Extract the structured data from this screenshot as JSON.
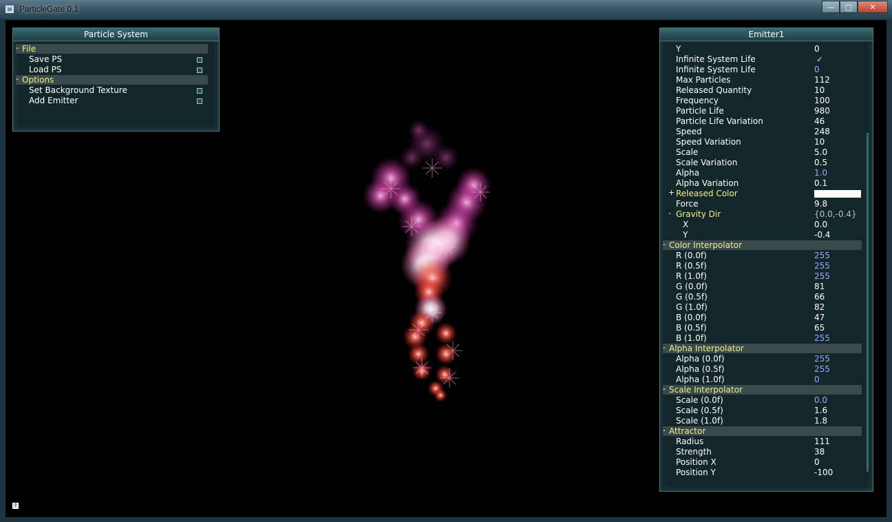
{
  "window": {
    "title": "ParticleGate 0.1",
    "min_label": "—",
    "max_label": "□",
    "close_label": "✕"
  },
  "particle_panel": {
    "title": "Particle System",
    "sections": [
      {
        "label": "File",
        "sign": "-",
        "items": [
          "Save PS",
          "Load PS"
        ]
      },
      {
        "label": "Options",
        "sign": "-",
        "items": [
          "Set Background Texture",
          "Add Emitter"
        ]
      }
    ]
  },
  "emitter_panel": {
    "title": "Emitter1",
    "rows": [
      {
        "label": "Y",
        "value": "0"
      },
      {
        "label": "Infinite System Life",
        "value": "✓",
        "checked": true
      },
      {
        "label": "Infinite System Life",
        "value": "0",
        "color": "blue"
      },
      {
        "label": "Max Particles",
        "value": "112"
      },
      {
        "label": "Released Quantity",
        "value": "10"
      },
      {
        "label": "Frequency",
        "value": "100"
      },
      {
        "label": "Particle Life",
        "value": "980"
      },
      {
        "label": "Particle Life Variation",
        "value": "46"
      },
      {
        "label": "Speed",
        "value": "248"
      },
      {
        "label": "Speed Variation",
        "value": "10"
      },
      {
        "label": "Scale",
        "value": "5.0"
      },
      {
        "label": "Scale Variation",
        "value": "0.5"
      },
      {
        "label": "Alpha",
        "value": "1.0",
        "color": "blue"
      },
      {
        "label": "Alpha Variation",
        "value": "0.1"
      },
      {
        "label": "Released Color",
        "sign": "+",
        "value": "",
        "swatch": "#ffffff",
        "highlight": true
      },
      {
        "label": "Force",
        "value": "9.8"
      },
      {
        "label": "Gravity Dir",
        "sign": "-",
        "value": "{0.0,-0.4}",
        "highlight": true,
        "color": "gray"
      },
      {
        "label": "X",
        "value": "0.0",
        "sub": true
      },
      {
        "label": "Y",
        "value": "-0.4",
        "sub": true
      },
      {
        "label": "Color Interpolator",
        "sign": "-",
        "section": true
      },
      {
        "label": "R (0.0f)",
        "value": "255",
        "color": "blue"
      },
      {
        "label": "R (0.5f)",
        "value": "255",
        "color": "blue"
      },
      {
        "label": "R (1.0f)",
        "value": "255",
        "color": "blue"
      },
      {
        "label": "G (0.0f)",
        "value": "81"
      },
      {
        "label": "G (0.5f)",
        "value": "66"
      },
      {
        "label": "G (1.0f)",
        "value": "82"
      },
      {
        "label": "B (0.0f)",
        "value": "47"
      },
      {
        "label": "B (0.5f)",
        "value": "65"
      },
      {
        "label": "B (1.0f)",
        "value": "255",
        "color": "blue"
      },
      {
        "label": "Alpha Interpolator",
        "sign": "-",
        "section": true
      },
      {
        "label": "Alpha (0.0f)",
        "value": "255",
        "color": "blue"
      },
      {
        "label": "Alpha (0.5f)",
        "value": "255",
        "color": "blue"
      },
      {
        "label": "Alpha (1.0f)",
        "value": "0",
        "color": "blue"
      },
      {
        "label": "Scale Interpolator",
        "sign": "-",
        "section": true
      },
      {
        "label": "Scale (0.0f)",
        "value": "0.0",
        "color": "blue"
      },
      {
        "label": "Scale (0.5f)",
        "value": "1.6"
      },
      {
        "label": "Scale (1.0f)",
        "value": "1.8"
      },
      {
        "label": "Attractor",
        "sign": "-",
        "section": true
      },
      {
        "label": "Radius",
        "value": "111"
      },
      {
        "label": "Strength",
        "value": "38"
      },
      {
        "label": "Position X",
        "value": "0"
      },
      {
        "label": "Position Y",
        "value": "-100"
      }
    ]
  },
  "colors": {
    "section_label": "#f3f08a",
    "value_blue": "#9ba8ff",
    "particle_core": "#ffffff",
    "particle_pink": "#ff5fd0",
    "particle_red": "#ff4a4a"
  },
  "icons": {
    "status": "help-icon",
    "checkmark": "checkmark-icon"
  }
}
